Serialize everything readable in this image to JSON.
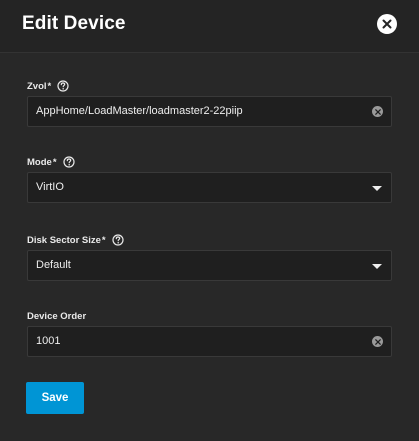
{
  "dialog": {
    "title": "Edit Device",
    "close_icon": "close-icon"
  },
  "zvol": {
    "label": "Zvol",
    "required_mark": "*",
    "value": "AppHome/LoadMaster/loadmaster2-22piip",
    "help_icon": "help-icon",
    "clear_icon": "clear-icon"
  },
  "mode": {
    "label": "Mode",
    "required_mark": "*",
    "value": "VirtIO",
    "help_icon": "help-icon",
    "dropdown_icon": "chevron-down-icon"
  },
  "disk_sector_size": {
    "label": "Disk Sector Size",
    "required_mark": "*",
    "value": "Default",
    "help_icon": "help-icon",
    "dropdown_icon": "chevron-down-icon"
  },
  "device_order": {
    "label": "Device Order",
    "value": "1001",
    "clear_icon": "clear-icon"
  },
  "actions": {
    "save_label": "Save"
  },
  "colors": {
    "background": "#282828",
    "field_background": "#1f1f1f",
    "accent": "#0095d5",
    "text": "#ffffff"
  }
}
